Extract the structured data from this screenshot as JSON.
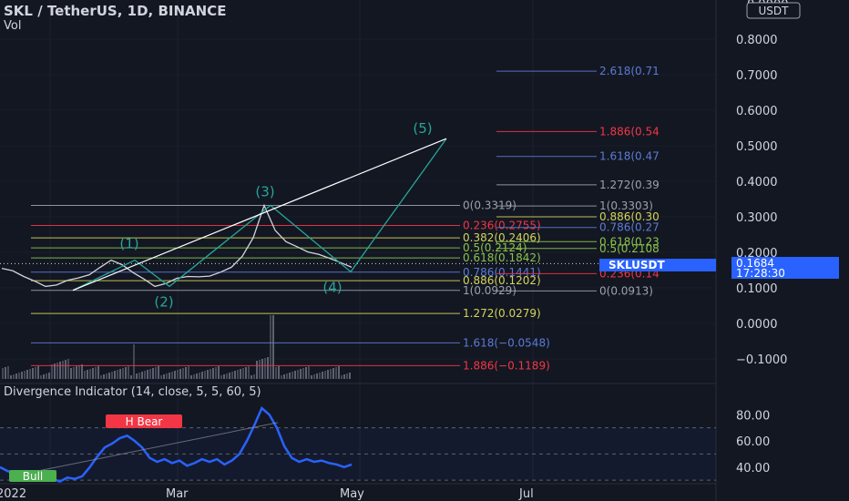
{
  "header": {
    "title": "SKL / TetherUS, 1D, BINANCE",
    "vol_label": "Vol",
    "currency_badge": "USDT",
    "top_tick_partial": "0.9000"
  },
  "colors": {
    "background": "#131722",
    "text": "#d1d4dc",
    "price_line": "#d1d4dc",
    "wave": "#26a69a",
    "trendline": "#ffffff",
    "divergence_line": "#2962ff",
    "bull_label": "#4caf50",
    "bear_label": "#f23645",
    "price_badge": "#2962ff",
    "fib_red": "#f23645",
    "fib_blue": "#5b7bd5",
    "fib_yellow": "#d4d45a",
    "fib_green": "#8bc34a",
    "fib_grey": "#9ba1ad"
  },
  "price_badge": {
    "symbol": "SKLUSDT",
    "price": "0.1684",
    "countdown": "17:28:30"
  },
  "x_axis_labels": [
    "2022",
    "Mar",
    "May",
    "Jul"
  ],
  "indicator": {
    "title": "Divergence Indicator (14, close, 5, 5, 60, 5)",
    "bear_label": "H Bear",
    "bull_label": "Bull"
  },
  "chart_data": [
    {
      "type": "line",
      "title": "SKL / TetherUS, 1D, BINANCE",
      "ylim": [
        -0.14,
        0.9
      ],
      "y_ticks": [
        "0.8000",
        "0.7000",
        "0.6000",
        "0.5000",
        "0.4000",
        "0.3000",
        "0.2000",
        "0.1000",
        "0.0000",
        "−0.1000"
      ],
      "current_price": 0.1684,
      "price_series": [
        0.155,
        0.148,
        0.132,
        0.119,
        0.104,
        0.108,
        0.121,
        0.128,
        0.137,
        0.158,
        0.178,
        0.165,
        0.143,
        0.125,
        0.104,
        0.112,
        0.127,
        0.132,
        0.131,
        0.133,
        0.144,
        0.158,
        0.189,
        0.241,
        0.332,
        0.262,
        0.23,
        0.216,
        0.201,
        0.194,
        0.183,
        0.171,
        0.158
      ],
      "wave_labels": [
        {
          "label": "(1)",
          "price": 0.178
        },
        {
          "label": "(2)",
          "price": 0.104
        },
        {
          "label": "(3)",
          "price": 0.332
        },
        {
          "label": "(4)",
          "price": 0.145
        },
        {
          "label": "(5)",
          "price": 0.52
        }
      ],
      "fib_left": [
        {
          "text": "0(0.3319)",
          "value": 0.3319,
          "color": "grey"
        },
        {
          "text": "0.236(0.2755)",
          "value": 0.2755,
          "color": "red"
        },
        {
          "text": "0.382(0.2406)",
          "value": 0.2406,
          "color": "yellow"
        },
        {
          "text": "0.5(0.2124)",
          "value": 0.2124,
          "color": "green"
        },
        {
          "text": "0.618(0.1842)",
          "value": 0.1842,
          "color": "green"
        },
        {
          "text": "0.786(0.1441)",
          "value": 0.1441,
          "color": "blue"
        },
        {
          "text": "0.886(0.1202)",
          "value": 0.1202,
          "color": "yellow"
        },
        {
          "text": "1(0.0929)",
          "value": 0.0929,
          "color": "grey"
        },
        {
          "text": "1.272(0.0279)",
          "value": 0.0279,
          "color": "yellow"
        },
        {
          "text": "1.618(−0.0548)",
          "value": -0.0548,
          "color": "blue"
        },
        {
          "text": "1.886(−0.1189)",
          "value": -0.1189,
          "color": "red"
        }
      ],
      "fib_right": [
        {
          "text": "2.618(0.71",
          "value": 0.71,
          "color": "blue"
        },
        {
          "text": "1.886(0.54",
          "value": 0.54,
          "color": "red"
        },
        {
          "text": "1.618(0.47",
          "value": 0.47,
          "color": "blue"
        },
        {
          "text": "1.272(0.39",
          "value": 0.39,
          "color": "grey"
        },
        {
          "text": "1(0.3303)",
          "value": 0.3303,
          "color": "grey"
        },
        {
          "text": "0.886(0.30",
          "value": 0.3,
          "color": "yellow"
        },
        {
          "text": "0.786(0.27",
          "value": 0.27,
          "color": "blue"
        },
        {
          "text": "0.618(0.23",
          "value": 0.23,
          "color": "green"
        },
        {
          "text": "0.5(0.2108",
          "value": 0.2108,
          "color": "green"
        },
        {
          "text": "0.236(0.14",
          "value": 0.14,
          "color": "red"
        },
        {
          "text": "0(0.0913)",
          "value": 0.0913,
          "color": "grey"
        }
      ]
    },
    {
      "type": "line",
      "title": "Divergence Indicator (14, close, 5, 5, 60, 5)",
      "ylim": [
        28,
        92
      ],
      "y_ticks": [
        "80.00",
        "60.00",
        "40.00"
      ],
      "levels": [
        70,
        50,
        30
      ],
      "values": [
        40,
        37,
        35,
        34,
        36,
        33,
        30,
        31,
        29,
        32,
        31,
        33,
        40,
        48,
        55,
        58,
        62,
        64,
        60,
        55,
        47,
        44,
        46,
        43,
        45,
        41,
        43,
        46,
        44,
        46,
        42,
        45,
        50,
        60,
        72,
        85,
        80,
        70,
        56,
        47,
        44,
        46,
        44,
        45,
        43,
        42,
        40,
        42
      ]
    }
  ]
}
